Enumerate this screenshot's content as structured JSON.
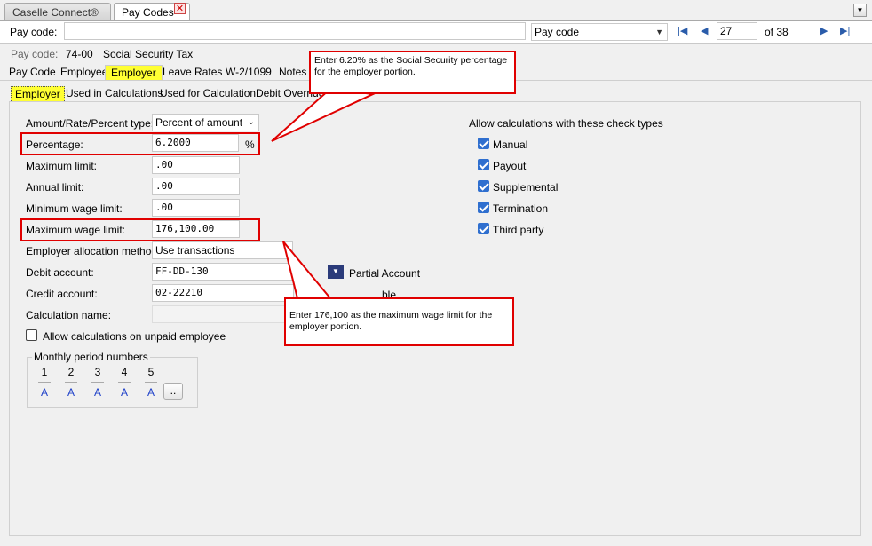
{
  "window_tabs": [
    {
      "label": "Caselle Connect®"
    },
    {
      "label": "Pay Codes"
    }
  ],
  "toolbar": {
    "pay_code_label": "Pay code:",
    "pay_code_value": "",
    "lookup_select": "Pay code",
    "record_number": "27",
    "record_total": "of 38"
  },
  "record": {
    "label": "Pay code:",
    "code": "74-00",
    "description": "Social Security Tax"
  },
  "primary_tabs": [
    "Pay Code",
    "Employee",
    "Employer",
    "Leave Rates",
    "W-2/1099",
    "Notes"
  ],
  "secondary_tabs": [
    "Employer",
    "Used in Calculations",
    "Used for Calculation",
    "Debit Override Acc"
  ],
  "form": {
    "amount_type_label": "Amount/Rate/Percent type:",
    "amount_type_value": "Percent of amount",
    "percentage_label": "Percentage:",
    "percentage_value": "6.2000",
    "percentage_unit": "%",
    "max_limit_label": "Maximum limit:",
    "max_limit_value": ".00",
    "annual_limit_label": "Annual limit:",
    "annual_limit_value": ".00",
    "min_wage_limit_label": "Minimum wage limit:",
    "min_wage_limit_value": ".00",
    "max_wage_limit_label": "Maximum wage limit:",
    "max_wage_limit_value": "176,100.00",
    "allocation_method_label": "Employer allocation method:",
    "allocation_method_value": "Use transactions",
    "debit_account_label": "Debit account:",
    "debit_account_value": "FF-DD-130",
    "partial_account_label": "Partial Account",
    "credit_account_label": "Credit account:",
    "credit_account_value": "02-22210",
    "credit_suffix": "ble",
    "calculation_name_label": "Calculation name:",
    "calculation_name_value": "",
    "allow_unpaid_label": "Allow calculations on unpaid employee"
  },
  "check_types": {
    "title": "Allow calculations with these check types",
    "items": [
      {
        "label": "Manual",
        "checked": true
      },
      {
        "label": "Payout",
        "checked": true
      },
      {
        "label": "Supplemental",
        "checked": true
      },
      {
        "label": "Termination",
        "checked": true
      },
      {
        "label": "Third party",
        "checked": true
      }
    ]
  },
  "monthly_periods": {
    "title": "Monthly period numbers",
    "numbers": [
      "1",
      "2",
      "3",
      "4",
      "5"
    ],
    "values": [
      "A",
      "A",
      "A",
      "A",
      "A"
    ],
    "more_button": ".."
  },
  "callouts": {
    "percentage_note": "Enter 6.20% as the Social Security percentage for the employer portion.",
    "wage_limit_note": "Enter 176,100 as the maximum wage limit for the employer portion."
  },
  "colors": {
    "highlight": "#ffff33",
    "callout_border": "#e00000",
    "checkbox": "#2f6fcf",
    "period_value": "#1e40c8"
  }
}
